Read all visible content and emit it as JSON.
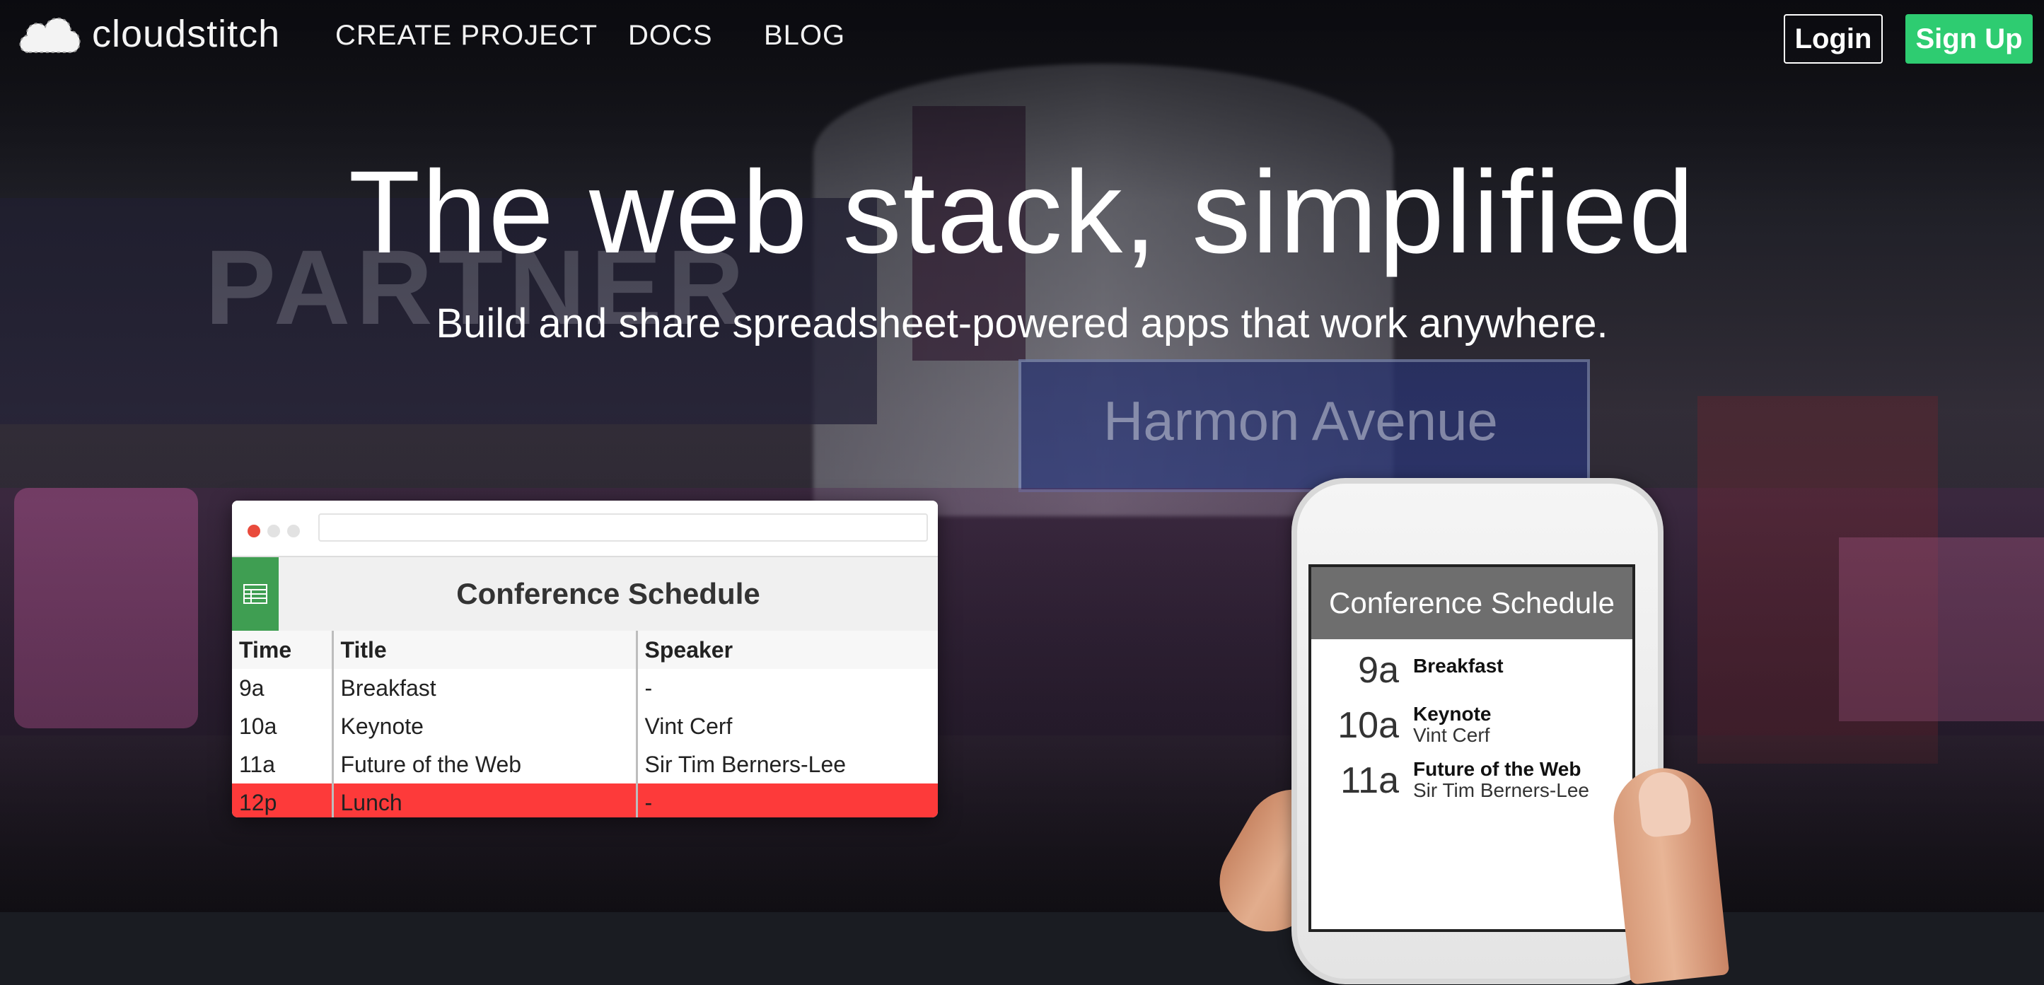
{
  "brand": {
    "name": "cloudstitch",
    "icon": "cloud-icon"
  },
  "nav": {
    "links": [
      {
        "label": "CREATE PROJECT"
      },
      {
        "label": "DOCS"
      },
      {
        "label": "BLOG"
      }
    ],
    "login_label": "Login",
    "signup_label": "Sign Up"
  },
  "hero": {
    "title": "The web stack, simplified",
    "subtitle": "Build and share spreadsheet-powered apps that work anywhere."
  },
  "spreadsheet": {
    "icon": "spreadsheet-icon",
    "title": "Conference Schedule",
    "columns": [
      "Time",
      "Title",
      "Speaker"
    ],
    "rows": [
      [
        "9a",
        "Breakfast",
        "-"
      ],
      [
        "10a",
        "Keynote",
        "Vint Cerf"
      ],
      [
        "11a",
        "Future of the Web",
        "Sir Tim Berners-Lee"
      ],
      [
        "12p",
        "Lunch",
        "-"
      ]
    ],
    "highlight_color": "#fd3a3a"
  },
  "mobile": {
    "title": "Conference Schedule",
    "items": [
      {
        "time": "9a",
        "title": "Breakfast",
        "speaker": ""
      },
      {
        "time": "10a",
        "title": "Keynote",
        "speaker": "Vint Cerf"
      },
      {
        "time": "11a",
        "title": "Future of the Web",
        "speaker": "Sir Tim Berners-Lee"
      }
    ]
  },
  "colors": {
    "accent": "#2ecc71",
    "sheet_green": "#3f9e52"
  }
}
